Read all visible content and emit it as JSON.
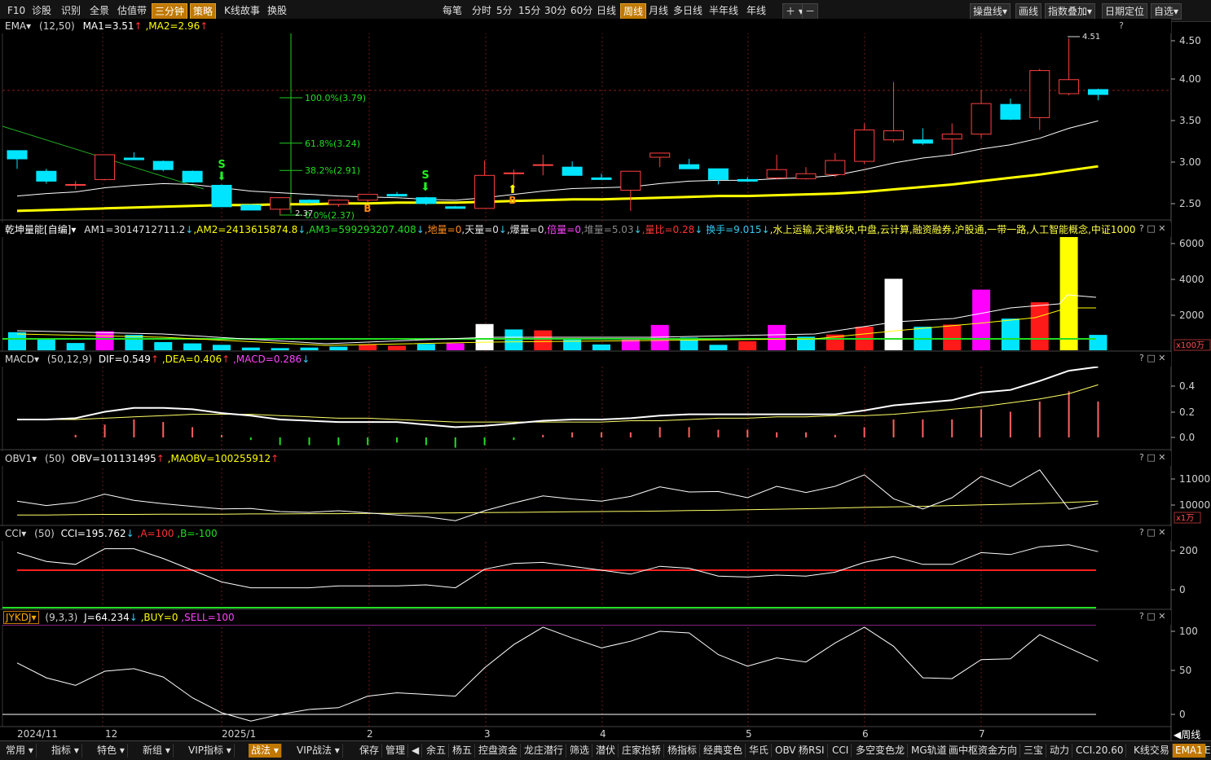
{
  "toolbar": {
    "left": [
      "F10",
      "诊股",
      "识别",
      "全景",
      "估值带",
      "三分钟",
      "策略",
      "K线故事",
      "换股"
    ],
    "periods": [
      "每笔",
      "分时",
      "5分",
      "15分",
      "30分",
      "60分",
      "日线",
      "周线",
      "月线",
      "多日线",
      "半年线",
      "年线"
    ],
    "active_period": "周线",
    "right": [
      "操盘线",
      "画线",
      "指数叠加",
      "日期定位",
      "自选"
    ]
  },
  "panels": {
    "main": {
      "name": "EMA",
      "params": "(12,50)",
      "ma1": "MA1=3.51",
      "ma2": ",MA2=2.96",
      "question": "?"
    },
    "vol": {
      "name": "乾坤量能[自编]",
      "values": [
        {
          "t": "AM1=3014712711.2",
          "c": "#e0e0e0"
        },
        {
          "t": "↓",
          "c": "#39c8f0"
        },
        {
          "t": ",AM2=2413615874.8",
          "c": "#ffff00"
        },
        {
          "t": "↓",
          "c": "#39c8f0"
        },
        {
          "t": ",AM3=599293207.408",
          "c": "#22dd22"
        },
        {
          "t": "↓",
          "c": "#39c8f0"
        },
        {
          "t": ",地量=0",
          "c": "#ff8c1a"
        },
        {
          "t": ",天量=0",
          "c": "#e0e0e0"
        },
        {
          "t": "↓",
          "c": "#39c8f0"
        },
        {
          "t": ",爆量=0",
          "c": "#e0e0e0"
        },
        {
          "t": ",倍量=0",
          "c": "#ff44ff"
        },
        {
          "t": ",堆量=5.03",
          "c": "#888888"
        },
        {
          "t": "↓",
          "c": "#39c8f0"
        },
        {
          "t": ",量比=0.28",
          "c": "#ff3333"
        },
        {
          "t": "↓",
          "c": "#39c8f0"
        },
        {
          "t": " 换手=9.015",
          "c": "#39c8f0"
        },
        {
          "t": "↓",
          "c": "#39c8f0"
        },
        {
          "t": ",水上运输,天津板块,中盘,云计算,融资融券,沪股通,一带一路,人工智能概念,中证1000",
          "c": "#ffff44"
        }
      ]
    },
    "macd": {
      "name": "MACD",
      "params": "(50,12,9)",
      "dif": "DIF=0.549",
      "dea": ",DEA=0.406",
      "macd": ",MACD=0.286"
    },
    "obv": {
      "name": "OBV1",
      "params": "(50)",
      "obv": "OBV=101131495",
      "maobv": ",MAOBV=100255912"
    },
    "cci": {
      "name": "CCI",
      "params": "(50)",
      "cci": "CCI=195.762",
      "a": ",A=100",
      "b": ",B=-100"
    },
    "kdj": {
      "name": "JYKDJ",
      "params": "(9,3,3)",
      "j": "J=64.234",
      "buy": ",BUY=0",
      "sell": ",SELL=100"
    }
  },
  "axes": {
    "main": [
      "4.50",
      "4.00",
      "3.50",
      "3.00",
      "2.50"
    ],
    "vol": [
      "6000",
      "4000",
      "2000"
    ],
    "vol_unit": "x100万",
    "macd": [
      "0.4",
      "0.2",
      "0.0"
    ],
    "obv": [
      "11000",
      "10000"
    ],
    "obv_unit": "x1万",
    "cci": [
      "200",
      "0"
    ],
    "kdj": [
      "100",
      "50",
      "0"
    ]
  },
  "fib": [
    "100.0%(3.79)",
    "61.8%(3.24)",
    "38.2%(2.91)",
    "0.0%(2.37)"
  ],
  "annotations": {
    "high": "4.51",
    "low": "2.37",
    "s": "S",
    "b": "B"
  },
  "dates": [
    "2024/11",
    "12",
    "2025/1",
    "2",
    "3",
    "4",
    "5",
    "6",
    "7"
  ],
  "period_label": "周线",
  "bottom_tabs": [
    "常用",
    "指标",
    "特色",
    "新组",
    "VIP指标",
    "战法",
    "VIP战法",
    "保存",
    "管理",
    "余五",
    "杨五",
    "控盘资金",
    "龙庄潜行",
    "筛选",
    "潜伏",
    "庄家抬轿",
    "杨指标",
    "经典变色",
    "华氏",
    "OBV",
    "杨RSI",
    "CCI",
    "多空变色龙",
    "MG轨道",
    "画中枢资金方向",
    "三宝",
    "动力",
    "CCI.20.60",
    "K线交易",
    "EMA1",
    "EMA"
  ],
  "active_bottom": [
    "战法",
    "EMA1"
  ],
  "chart_data": {
    "type": "candlestick",
    "ohlc": [
      [
        3.15,
        3.08,
        2.93,
        3.05
      ],
      [
        2.9,
        2.93,
        2.75,
        2.78
      ],
      [
        2.73,
        2.78,
        2.68,
        2.74
      ],
      [
        2.8,
        3.1,
        2.79,
        3.1
      ],
      [
        3.06,
        3.13,
        3.04,
        3.04
      ],
      [
        3.02,
        3.03,
        2.9,
        2.92
      ],
      [
        2.9,
        2.91,
        2.76,
        2.77
      ],
      [
        2.73,
        2.74,
        2.47,
        2.47
      ],
      [
        2.49,
        2.5,
        2.43,
        2.43
      ],
      [
        2.44,
        2.58,
        2.37,
        2.58
      ],
      [
        2.55,
        2.56,
        2.5,
        2.52
      ],
      [
        2.5,
        2.56,
        2.47,
        2.55
      ],
      [
        2.55,
        2.62,
        2.52,
        2.62
      ],
      [
        2.62,
        2.65,
        2.6,
        2.6
      ],
      [
        2.58,
        2.59,
        2.49,
        2.51
      ],
      [
        2.47,
        2.48,
        2.45,
        2.45
      ],
      [
        2.45,
        3.03,
        2.45,
        2.85
      ],
      [
        2.88,
        2.92,
        2.65,
        2.88
      ],
      [
        2.97,
        3.1,
        2.85,
        2.98
      ],
      [
        2.95,
        3.02,
        2.85,
        2.85
      ],
      [
        2.82,
        2.87,
        2.8,
        2.8
      ],
      [
        2.67,
        2.9,
        2.42,
        2.9
      ],
      [
        3.07,
        3.12,
        2.95,
        3.12
      ],
      [
        2.98,
        3.05,
        2.93,
        2.93
      ],
      [
        2.93,
        2.93,
        2.74,
        2.8
      ],
      [
        2.8,
        2.83,
        2.77,
        2.78
      ],
      [
        2.82,
        3.1,
        2.8,
        2.92
      ],
      [
        2.81,
        2.95,
        2.8,
        2.87
      ],
      [
        2.86,
        3.12,
        2.83,
        3.03
      ],
      [
        3.02,
        3.48,
        2.99,
        3.4
      ],
      [
        3.28,
        3.98,
        3.25,
        3.39
      ],
      [
        3.28,
        3.42,
        3.22,
        3.24
      ],
      [
        3.29,
        3.48,
        3.1,
        3.35
      ],
      [
        3.35,
        3.88,
        3.3,
        3.72
      ],
      [
        3.71,
        3.78,
        3.52,
        3.53
      ],
      [
        3.55,
        4.14,
        3.4,
        4.12
      ],
      [
        3.84,
        4.51,
        3.82,
        4.01
      ],
      [
        3.89,
        3.9,
        3.76,
        3.83
      ]
    ],
    "ma1": [
      2.6,
      2.63,
      2.65,
      2.7,
      2.73,
      2.75,
      2.74,
      2.7,
      2.66,
      2.64,
      2.62,
      2.6,
      2.59,
      2.58,
      2.56,
      2.55,
      2.58,
      2.62,
      2.66,
      2.69,
      2.7,
      2.71,
      2.75,
      2.78,
      2.79,
      2.79,
      2.81,
      2.82,
      2.85,
      2.92,
      3.0,
      3.06,
      3.1,
      3.17,
      3.22,
      3.3,
      3.42,
      3.51
    ],
    "ma2": [
      2.42,
      2.43,
      2.44,
      2.45,
      2.46,
      2.47,
      2.48,
      2.49,
      2.49,
      2.5,
      2.5,
      2.51,
      2.51,
      2.52,
      2.52,
      2.52,
      2.53,
      2.54,
      2.55,
      2.56,
      2.56,
      2.57,
      2.58,
      2.59,
      2.6,
      2.6,
      2.61,
      2.62,
      2.63,
      2.65,
      2.68,
      2.71,
      2.74,
      2.78,
      2.82,
      2.86,
      2.91,
      2.96
    ],
    "volume": [
      1000,
      600,
      400,
      1050,
      850,
      450,
      380,
      300,
      150,
      120,
      150,
      200,
      330,
      250,
      350,
      380,
      1450,
      1150,
      1100,
      620,
      320,
      650,
      1400,
      700,
      300,
      500,
      1400,
      750,
      870,
      1300,
      3950,
      1300,
      1420,
      3350,
      1750,
      2650,
      6300,
      850
    ],
    "volume_colors": [
      "c",
      "c",
      "c",
      "m",
      "c",
      "c",
      "c",
      "c",
      "c",
      "c",
      "c",
      "c",
      "r",
      "r",
      "c",
      "m",
      "w",
      "c",
      "r",
      "c",
      "c",
      "m",
      "m",
      "c",
      "c",
      "r",
      "m",
      "c",
      "r",
      "r",
      "w",
      "c",
      "r",
      "m",
      "c",
      "r",
      "y",
      "c"
    ],
    "dif": [
      0.14,
      0.14,
      0.15,
      0.2,
      0.23,
      0.23,
      0.22,
      0.19,
      0.17,
      0.14,
      0.13,
      0.12,
      0.12,
      0.12,
      0.1,
      0.08,
      0.09,
      0.11,
      0.13,
      0.14,
      0.14,
      0.15,
      0.17,
      0.18,
      0.18,
      0.18,
      0.18,
      0.18,
      0.18,
      0.21,
      0.25,
      0.27,
      0.29,
      0.35,
      0.37,
      0.44,
      0.52,
      0.55
    ],
    "dea": [
      0.14,
      0.14,
      0.14,
      0.15,
      0.16,
      0.17,
      0.18,
      0.18,
      0.18,
      0.17,
      0.16,
      0.15,
      0.15,
      0.14,
      0.13,
      0.12,
      0.12,
      0.12,
      0.12,
      0.12,
      0.12,
      0.13,
      0.13,
      0.14,
      0.15,
      0.15,
      0.16,
      0.16,
      0.17,
      0.17,
      0.18,
      0.2,
      0.22,
      0.24,
      0.27,
      0.3,
      0.34,
      0.41
    ],
    "obv": [
      10150,
      9980,
      10100,
      10420,
      10180,
      10050,
      9950,
      9850,
      9870,
      9750,
      9720,
      9780,
      9700,
      9620,
      9550,
      9400,
      9780,
      10080,
      10350,
      10230,
      10150,
      10330,
      10700,
      10500,
      10520,
      10280,
      10720,
      10480,
      10720,
      11160,
      10240,
      9850,
      10280,
      11100,
      10700,
      11350,
      9840,
      10050
    ],
    "maobv": [
      9620,
      9620,
      9630,
      9640,
      9640,
      9650,
      9650,
      9650,
      9660,
      9660,
      9670,
      9670,
      9680,
      9680,
      9690,
      9700,
      9710,
      9720,
      9730,
      9740,
      9750,
      9760,
      9770,
      9790,
      9800,
      9820,
      9840,
      9860,
      9880,
      9910,
      9930,
      9950,
      9980,
      10010,
      10030,
      10060,
      10100,
      10150
    ],
    "cci": [
      190,
      145,
      130,
      210,
      210,
      160,
      100,
      40,
      10,
      10,
      10,
      20,
      20,
      20,
      25,
      10,
      105,
      135,
      140,
      120,
      100,
      80,
      120,
      110,
      70,
      65,
      75,
      70,
      90,
      140,
      170,
      130,
      130,
      190,
      180,
      220,
      230,
      195
    ],
    "kdj_j": [
      62,
      44,
      35,
      52,
      55,
      45,
      20,
      2,
      -8,
      0,
      6,
      8,
      22,
      26,
      24,
      22,
      56,
      84,
      105,
      92,
      80,
      88,
      100,
      98,
      72,
      58,
      68,
      63,
      86,
      105,
      82,
      44,
      43,
      66,
      67,
      96,
      80,
      64
    ],
    "dates": [
      "2024/11",
      "12",
      "2025/1",
      "2",
      "3",
      "4",
      "5",
      "6",
      "7"
    ]
  }
}
